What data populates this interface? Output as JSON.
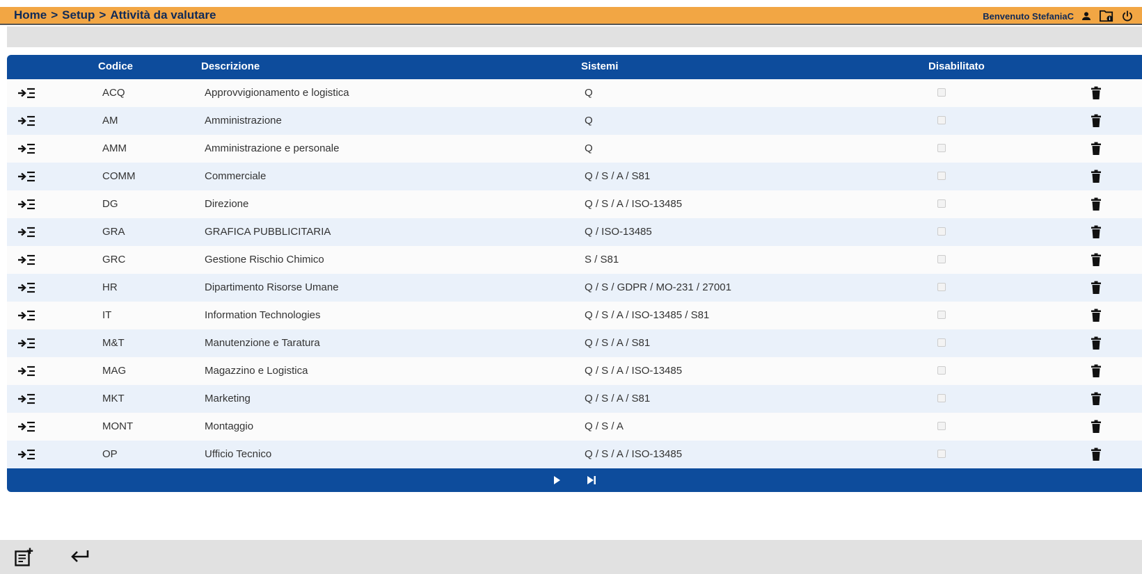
{
  "header": {
    "breadcrumb": [
      "Home",
      "Setup",
      "Attività da valutare"
    ],
    "separator": ">",
    "welcome": "Benvenuto StefaniaC"
  },
  "table": {
    "columns": {
      "code": "Codice",
      "description": "Descrizione",
      "systems": "Sistemi",
      "disabled": "Disabilitato"
    },
    "rows": [
      {
        "code": "ACQ",
        "description": "Approvvigionamento e logistica",
        "systems": "Q",
        "disabled": false
      },
      {
        "code": "AM",
        "description": "Amministrazione",
        "systems": "Q",
        "disabled": false
      },
      {
        "code": "AMM",
        "description": "Amministrazione e personale",
        "systems": "Q",
        "disabled": false
      },
      {
        "code": "COMM",
        "description": "Commerciale",
        "systems": "Q / S / A / S81",
        "disabled": false
      },
      {
        "code": "DG",
        "description": "Direzione",
        "systems": "Q / S / A / ISO-13485",
        "disabled": false
      },
      {
        "code": "GRA",
        "description": "GRAFICA PUBBLICITARIA",
        "systems": "Q / ISO-13485",
        "disabled": false
      },
      {
        "code": "GRC",
        "description": "Gestione Rischio Chimico",
        "systems": "S / S81",
        "disabled": false
      },
      {
        "code": "HR",
        "description": "Dipartimento Risorse Umane",
        "systems": "Q / S / GDPR / MO-231 / 27001",
        "disabled": false
      },
      {
        "code": "IT",
        "description": "Information Technologies",
        "systems": "Q / S / A / ISO-13485 / S81",
        "disabled": false
      },
      {
        "code": "M&T",
        "description": "Manutenzione e Taratura",
        "systems": "Q / S / A / S81",
        "disabled": false
      },
      {
        "code": "MAG",
        "description": "Magazzino e Logistica",
        "systems": "Q / S / A / ISO-13485",
        "disabled": false
      },
      {
        "code": "MKT",
        "description": "Marketing",
        "systems": "Q / S / A / S81",
        "disabled": false
      },
      {
        "code": "MONT",
        "description": "Montaggio",
        "systems": "Q / S / A",
        "disabled": false
      },
      {
        "code": "OP",
        "description": "Ufficio Tecnico",
        "systems": "Q / S / A / ISO-13485",
        "disabled": false
      }
    ]
  },
  "icons": {
    "row_open": "indent-arrow-icon",
    "row_delete": "trash-icon",
    "user": "user-icon",
    "folder": "folder-info-icon",
    "power": "power-icon",
    "pager_next": "play-next-icon",
    "pager_last": "skip-last-icon",
    "new_record": "note-add-icon",
    "back": "return-arrow-icon"
  },
  "colors": {
    "topbar": "#f2a644",
    "table_header": "#0d4c9c",
    "row_alt": "#eaf1fa",
    "breadcrumb_text": "#0f2a58"
  }
}
